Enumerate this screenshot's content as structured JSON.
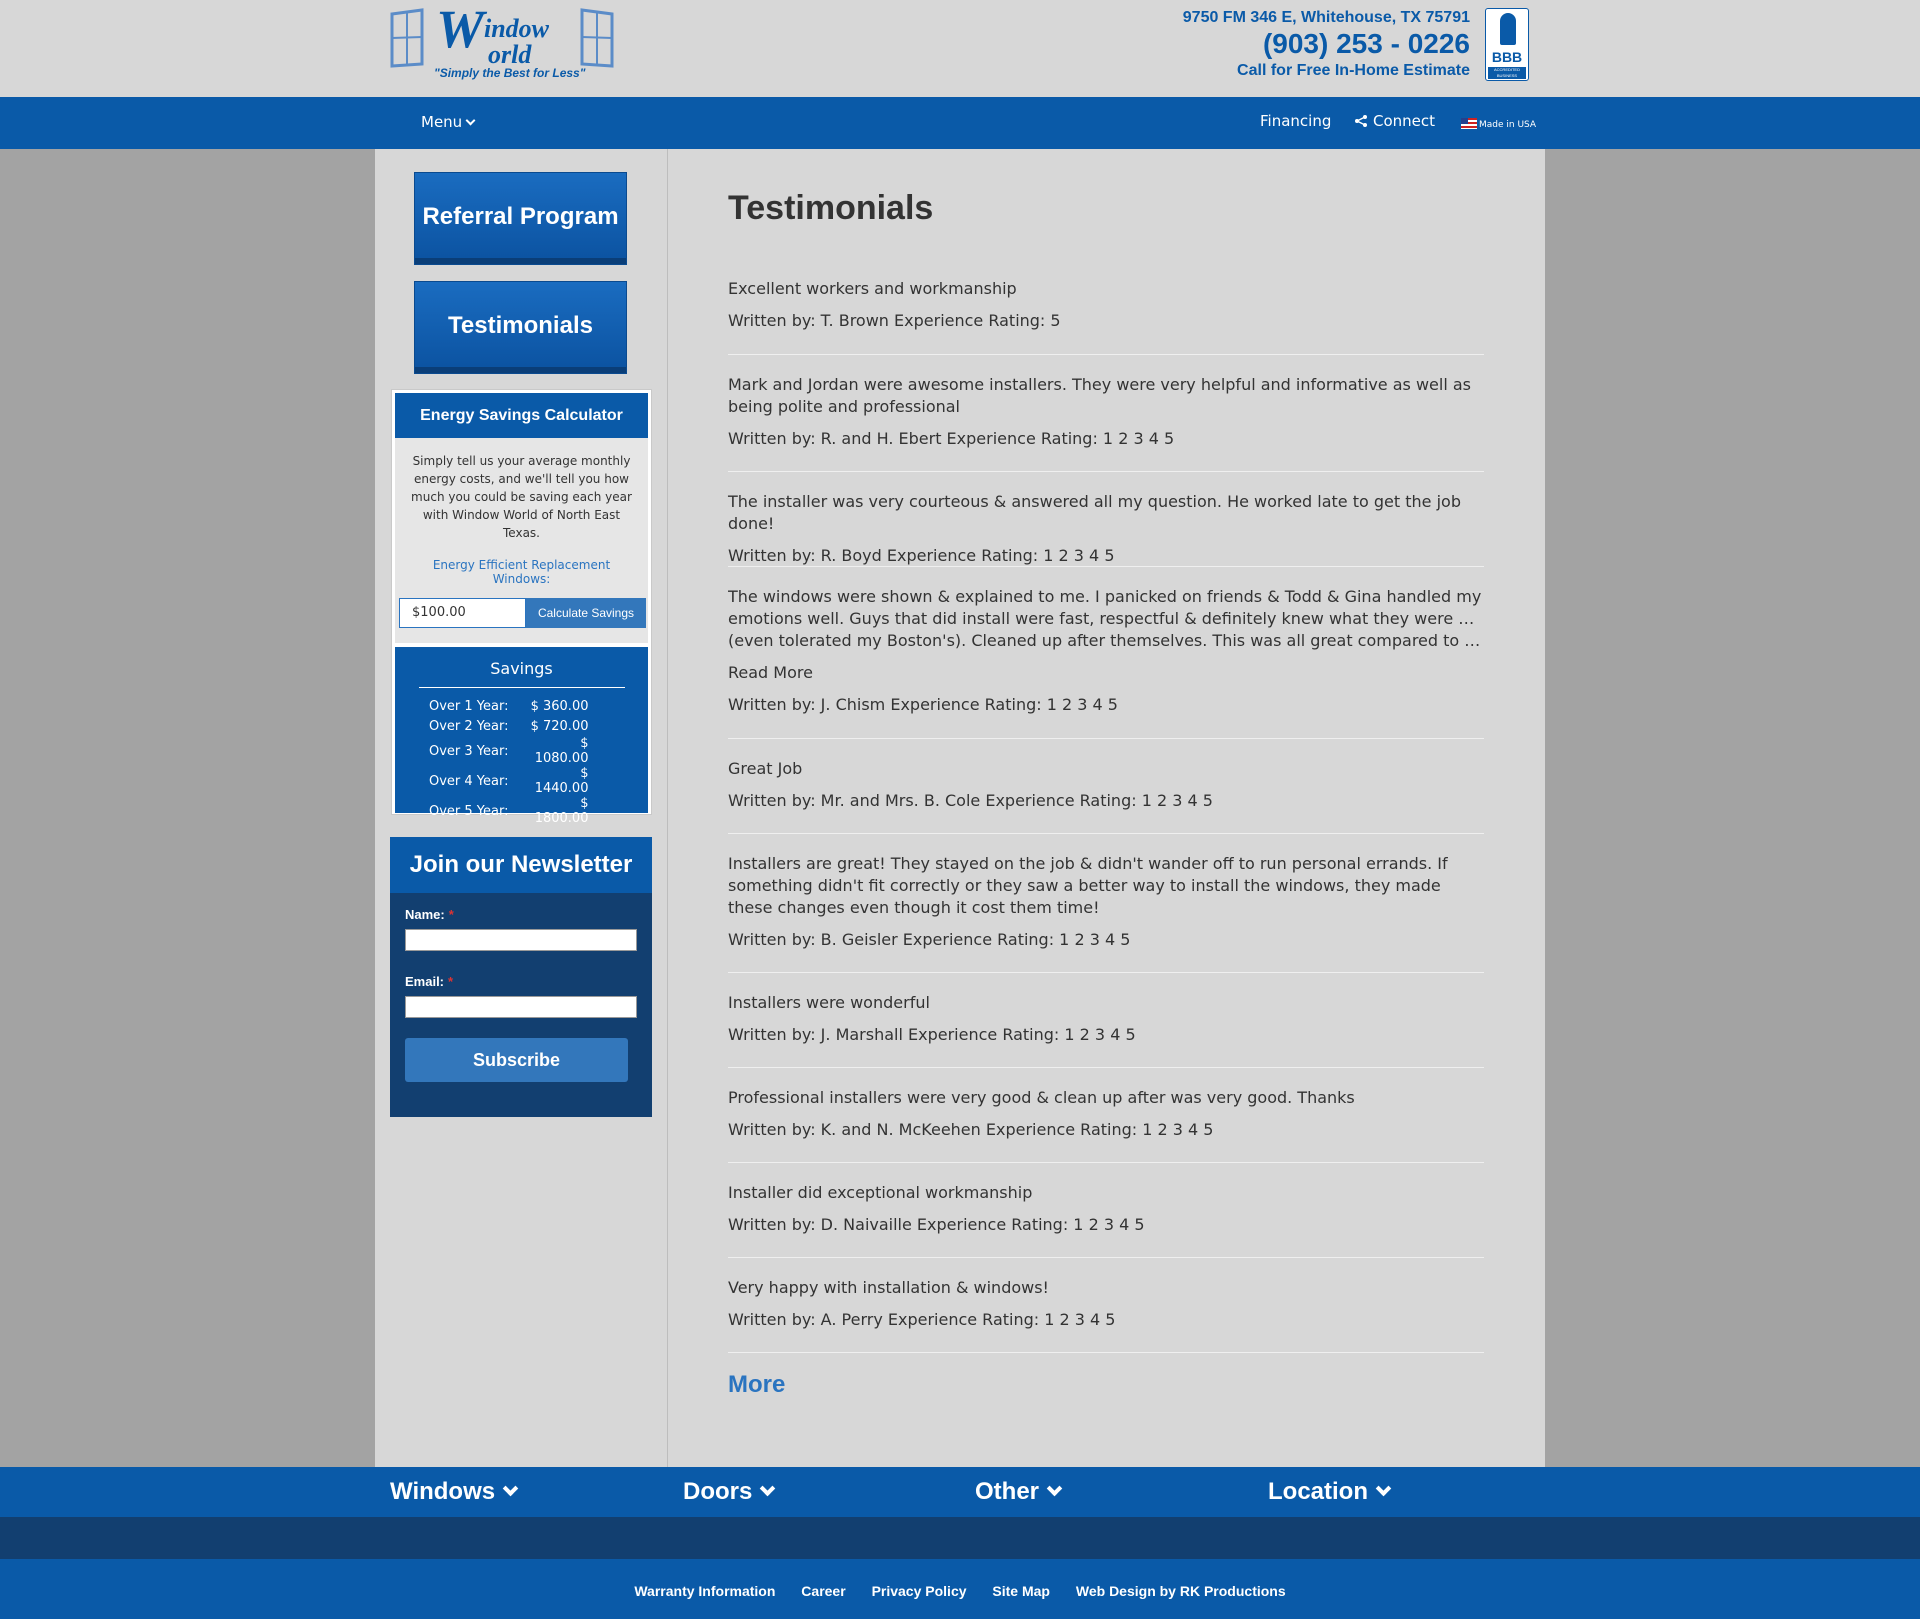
{
  "brand": {
    "logo_text": "Window World",
    "tagline": "\"Simply the Best for Less\""
  },
  "contact": {
    "address": "9750 FM 346 E, Whitehouse, TX 75791",
    "phone": "(903) 253 - 0226",
    "cta": "Call for Free In-Home Estimate"
  },
  "bbb": {
    "label": "BBB",
    "sub": "ACCREDITED BUSINESS"
  },
  "nav": {
    "menu": "Menu",
    "financing": "Financing",
    "connect": "Connect",
    "made_in_usa": "Made in USA"
  },
  "sidebar": {
    "referral": "Referral Program",
    "testimonials": "Testimonials",
    "calculator": {
      "title": "Energy Savings Calculator",
      "description": "Simply tell us your average monthly energy costs, and we'll tell you how much you could be saving each year with Window World of North East Texas.",
      "efficient_label": "Energy Efficient Replacement Windows:",
      "amount_value": "$100.00",
      "button": "Calculate Savings",
      "savings_title": "Savings",
      "savings": [
        {
          "label": "Over 1 Year:",
          "value": "$ 360.00"
        },
        {
          "label": "Over 2 Year:",
          "value": "$ 720.00"
        },
        {
          "label": "Over 3 Year:",
          "value": "$ 1080.00"
        },
        {
          "label": "Over 4 Year:",
          "value": "$ 1440.00"
        },
        {
          "label": "Over 5 Year:",
          "value": "$ 1800.00"
        }
      ]
    },
    "newsletter": {
      "title": "Join our Newsletter",
      "name_label": "Name:",
      "email_label": "Email:",
      "required_mark": "*",
      "subscribe": "Subscribe"
    }
  },
  "main": {
    "title": "Testimonials",
    "testimonials": [
      {
        "text": "Excellent workers and workmanship",
        "by": "Written by: T. Brown Experience Rating: 5"
      },
      {
        "text": "Mark and Jordan were awesome installers. They were very helpful and informative as well as being polite and professional",
        "by": "Written by: R. and H. Ebert Experience Rating: 1 2 3 4 5"
      },
      {
        "text": "The installer was very courteous & answered all my question. He worked late to get the job done!",
        "by": "Written by: R. Boyd Experience Rating: 1 2 3 4 5"
      },
      {
        "text_lines": [
          "The windows were shown & explained to me. I panicked on friends & Todd & Gina handled my",
          "emotions well. Guys that did install were fast, respectful & definitely knew what they were doing",
          "(even tolerated my Boston's). Cleaned up after themselves. This was all great compared to others I..."
        ],
        "read_more": "Read More",
        "by": "Written by: J. Chism Experience Rating: 1 2 3 4 5"
      },
      {
        "text": "Great Job",
        "by": "Written by: Mr. and Mrs. B. Cole Experience Rating: 1 2 3 4 5"
      },
      {
        "text": "Installers are great! They stayed on the job & didn't wander off to run personal errands. If something didn't fit correctly or they saw a better way to install the windows, they made these changes even though it cost them time!",
        "by": "Written by: B. Geisler Experience Rating: 1 2 3 4 5"
      },
      {
        "text": "Installers were wonderful",
        "by": "Written by: J. Marshall Experience Rating: 1 2 3 4 5"
      },
      {
        "text": "Professional installers were very good & clean up after was very good. Thanks",
        "by": "Written by: K. and N. McKeehen Experience Rating: 1 2 3 4 5"
      },
      {
        "text": "Installer did exceptional workmanship",
        "by": "Written by: D. Naivaille Experience Rating: 1 2 3 4 5"
      },
      {
        "text": "Very happy with installation & windows!",
        "by": "Written by: A. Perry Experience Rating: 1 2 3 4 5"
      }
    ],
    "more": "More"
  },
  "footer": {
    "nav": [
      "Windows",
      "Doors",
      "Other",
      "Location"
    ],
    "links": [
      "Warranty Information",
      "Career",
      "Privacy Policy",
      "Site Map",
      "Web Design by RK Productions"
    ]
  },
  "colors": {
    "brand_blue": "#0a5aa8",
    "dark_blue": "#123f70",
    "link_blue": "#2a74c0",
    "page_gray": "#d7d7d7"
  }
}
